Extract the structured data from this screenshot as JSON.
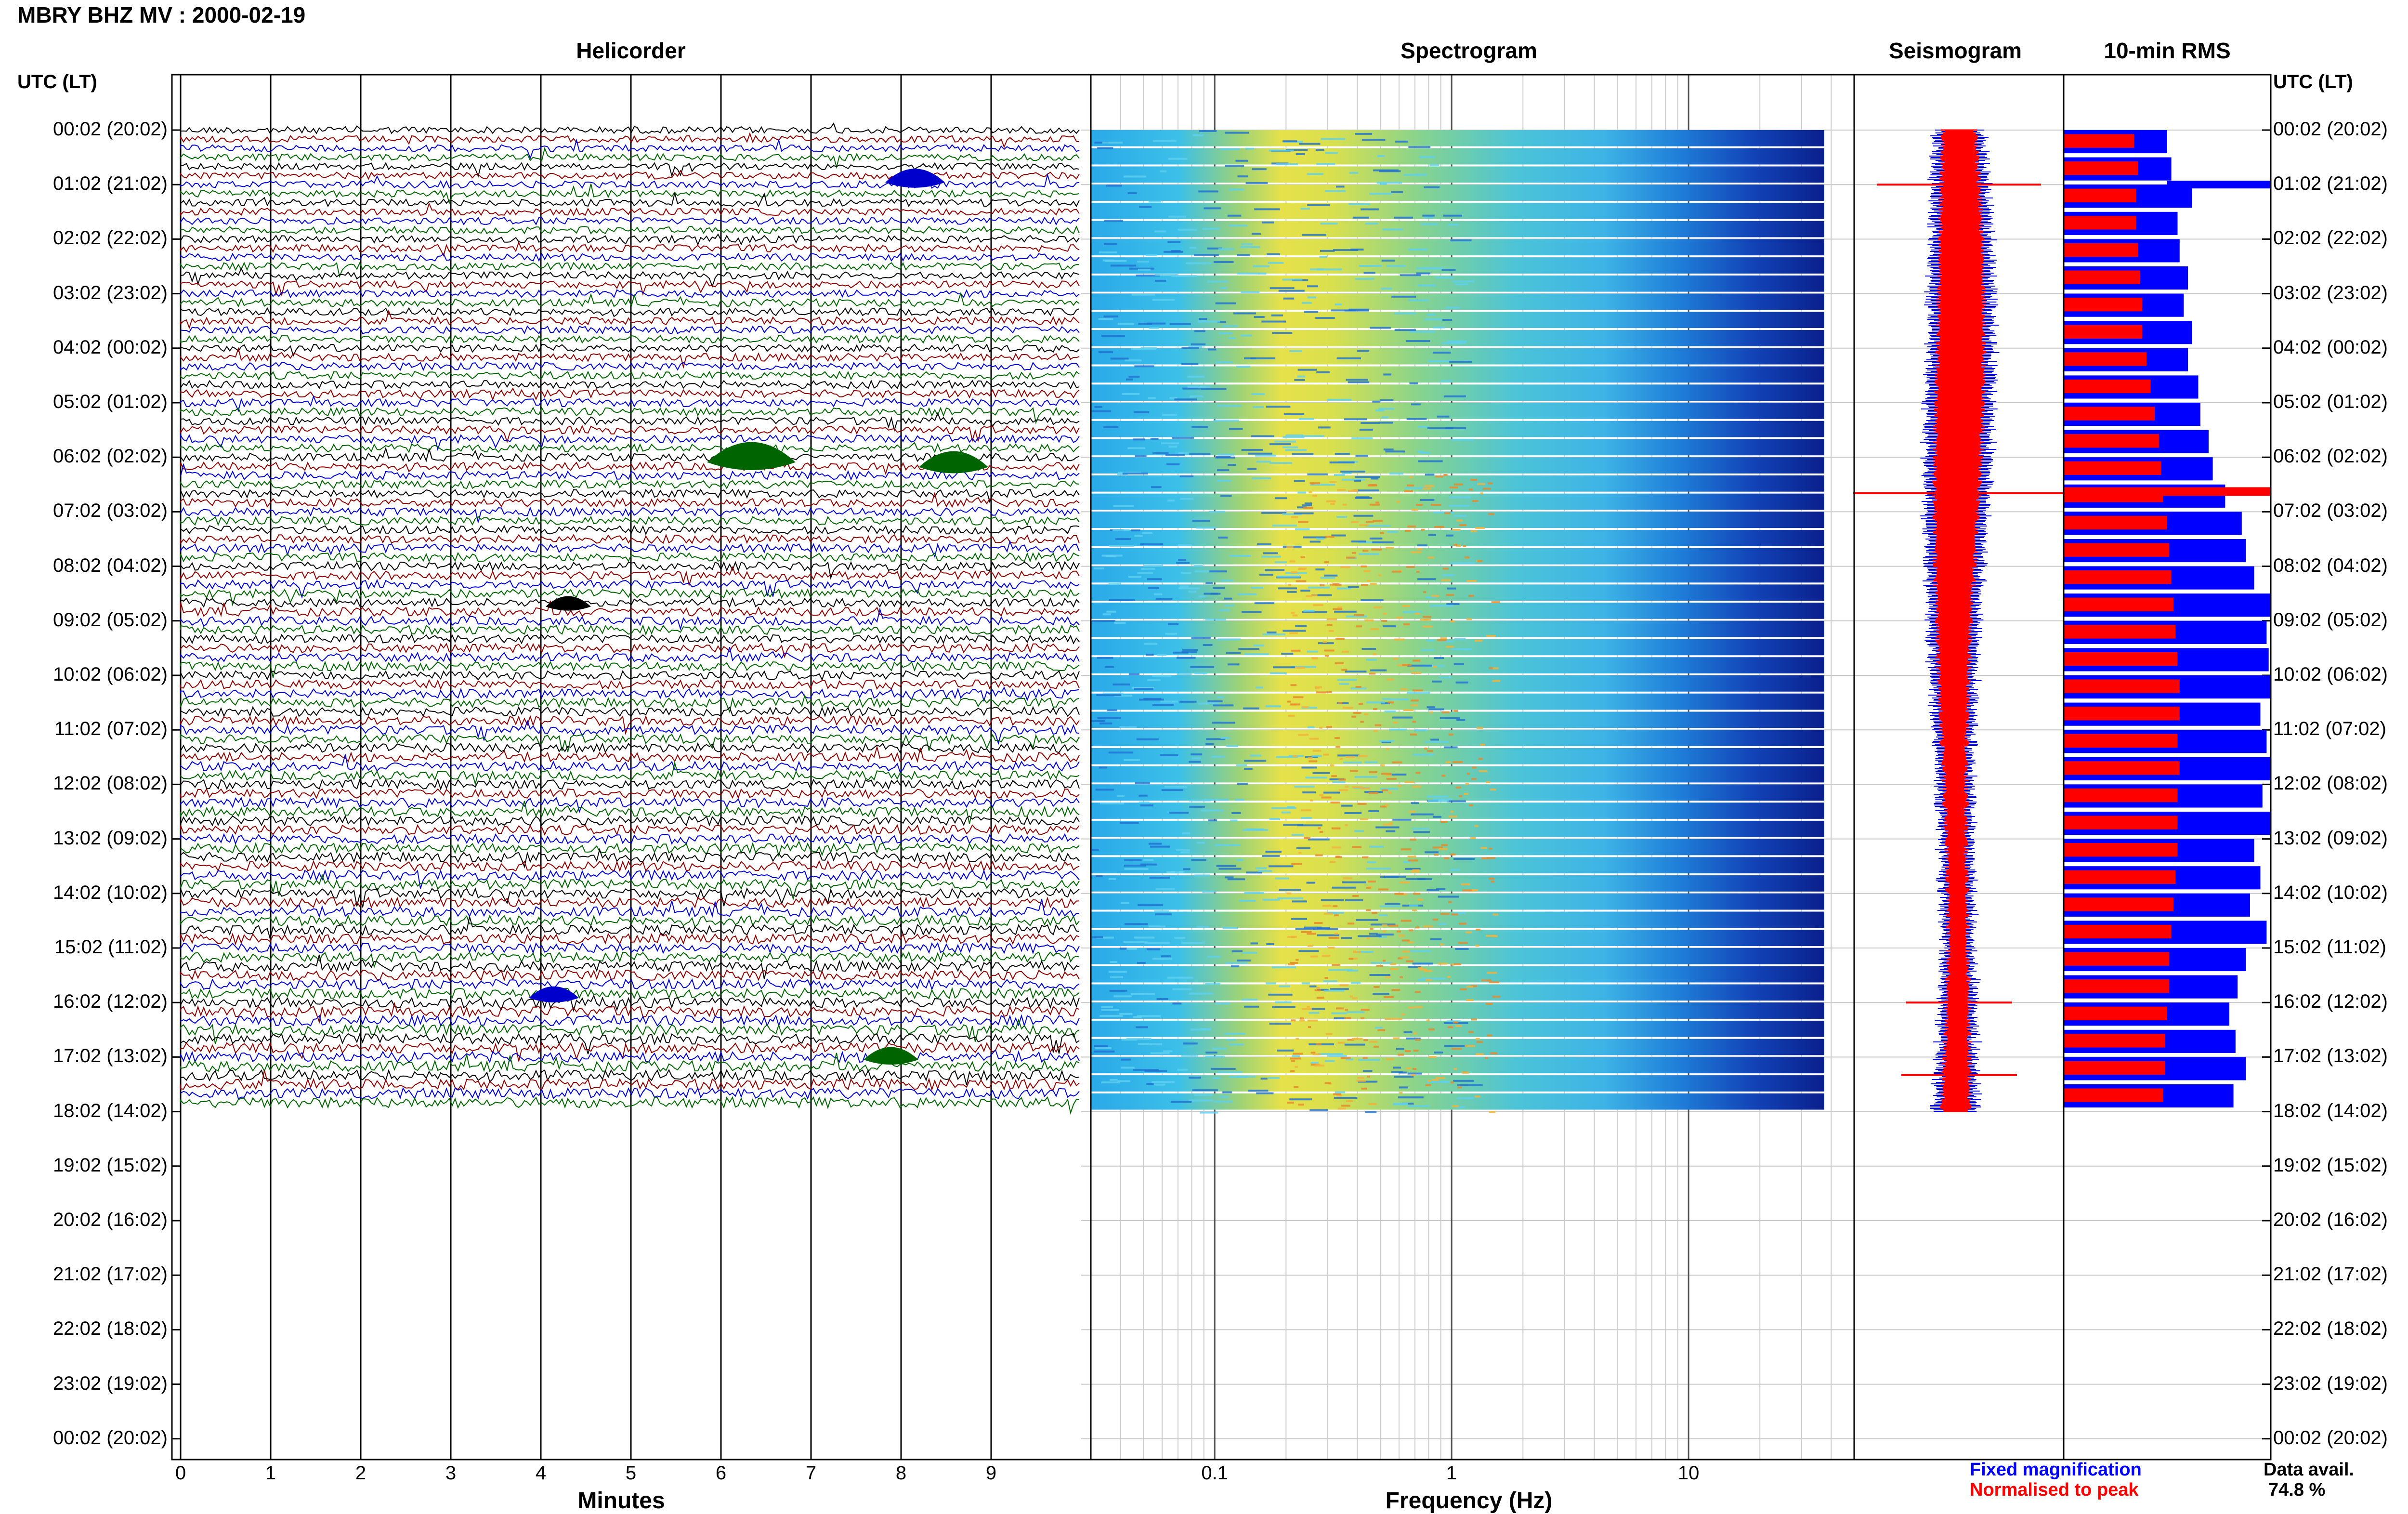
{
  "title": "MBRY BHZ MV : 2000-02-19",
  "panels": {
    "helicorder": "Helicorder",
    "spectrogram": "Spectrogram",
    "seismogram": "Seismogram",
    "rms": "10-min RMS"
  },
  "utc_header": "UTC (LT)",
  "time_labels": [
    "00:02 (20:02)",
    "01:02 (21:02)",
    "02:02 (22:02)",
    "03:02 (23:02)",
    "04:02 (00:02)",
    "05:02 (01:02)",
    "06:02 (02:02)",
    "07:02 (03:02)",
    "08:02 (04:02)",
    "09:02 (05:02)",
    "10:02 (06:02)",
    "11:02 (07:02)",
    "12:02 (08:02)",
    "13:02 (09:02)",
    "14:02 (10:02)",
    "15:02 (11:02)",
    "16:02 (12:02)",
    "17:02 (13:02)",
    "18:02 (14:02)",
    "19:02 (15:02)",
    "20:02 (16:02)",
    "21:02 (17:02)",
    "22:02 (18:02)",
    "23:02 (19:02)",
    "00:02 (20:02)"
  ],
  "axes": {
    "helicorder_xlabel": "Minutes",
    "helicorder_ticks": [
      "0",
      "1",
      "2",
      "3",
      "4",
      "5",
      "6",
      "7",
      "8",
      "9"
    ],
    "spectrogram_xlabel": "Frequency (Hz)",
    "spectrogram_ticks": [
      "0.1",
      "1",
      "10"
    ]
  },
  "legend": {
    "fixed": "Fixed magnification",
    "normalised": "Normalised to peak",
    "data_avail_label": "Data avail.",
    "data_avail_value": "74.8 %"
  },
  "colors": {
    "trace_black": "#000000",
    "trace_red": "#8b0000",
    "trace_blue": "#0000cc",
    "trace_green": "#006400",
    "rms_fixed": "#0000ff",
    "rms_normalised": "#ff0000",
    "legend_fixed": "#0000ff",
    "legend_normalised": "#ff0000"
  },
  "chart_data": {
    "type": "heatmap",
    "helicorder": {
      "x_range_minutes": [
        0,
        10
      ],
      "hours_with_data": 18,
      "trace_color_cycle": [
        "black",
        "red",
        "blue",
        "green"
      ]
    },
    "spectrogram": {
      "x_scale": "log",
      "x_range_hz": [
        0.03,
        50
      ],
      "data_hours": [
        0,
        18
      ]
    },
    "rms": {
      "series": [
        {
          "name": "Fixed magnification",
          "values": [
            0.5,
            0.52,
            0.62,
            0.55,
            0.56,
            0.6,
            0.58,
            0.62,
            0.6,
            0.65,
            0.66,
            0.7,
            0.72,
            0.78,
            0.86,
            0.88,
            0.92,
            1.0,
            0.98,
            0.99,
            1.0,
            0.95,
            0.98,
            1.0,
            0.96,
            1.0,
            0.92,
            0.95,
            0.9,
            0.98,
            0.88,
            0.84,
            0.8,
            0.83,
            0.88,
            0.82
          ]
        },
        {
          "name": "Normalised to peak",
          "values": [
            0.34,
            0.36,
            0.35,
            0.35,
            0.36,
            0.37,
            0.38,
            0.38,
            0.4,
            0.42,
            0.44,
            0.46,
            0.47,
            0.48,
            0.5,
            0.51,
            0.52,
            0.53,
            0.54,
            0.55,
            0.56,
            0.56,
            0.55,
            0.56,
            0.55,
            0.55,
            0.55,
            0.54,
            0.53,
            0.52,
            0.51,
            0.51,
            0.5,
            0.49,
            0.49,
            0.48
          ]
        }
      ]
    }
  }
}
